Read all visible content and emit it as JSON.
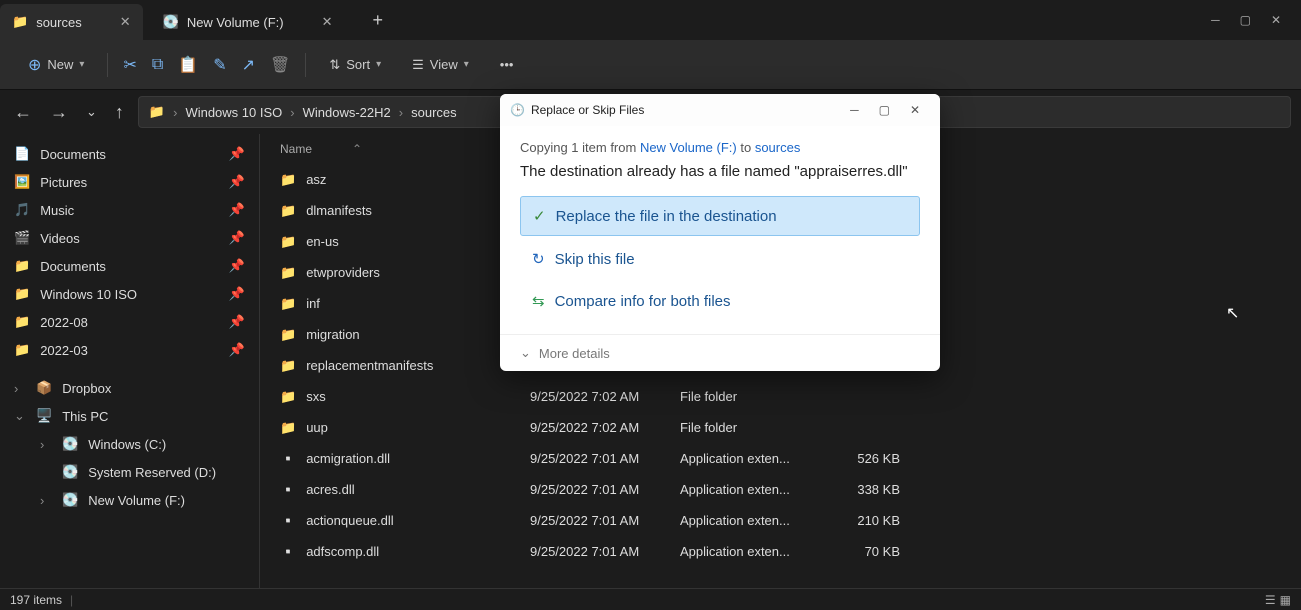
{
  "tabs": [
    {
      "label": "sources",
      "icon": "folder"
    },
    {
      "label": "New Volume (F:)",
      "icon": "drive"
    }
  ],
  "toolbar": {
    "new": "New",
    "sort": "Sort",
    "view": "View"
  },
  "breadcrumb": [
    "Windows 10 ISO",
    "Windows-22H2",
    "sources"
  ],
  "sidebar": {
    "quick": [
      {
        "label": "Documents",
        "icon": "doc"
      },
      {
        "label": "Pictures",
        "icon": "pic"
      },
      {
        "label": "Music",
        "icon": "music"
      },
      {
        "label": "Videos",
        "icon": "video"
      },
      {
        "label": "Documents",
        "icon": "folder"
      },
      {
        "label": "Windows 10 ISO",
        "icon": "folder"
      },
      {
        "label": "2022-08",
        "icon": "folder"
      },
      {
        "label": "2022-03",
        "icon": "folder"
      }
    ],
    "tree": [
      {
        "label": "Dropbox",
        "icon": "dropbox",
        "chev": "›"
      },
      {
        "label": "This PC",
        "icon": "pc",
        "chev": "⌄"
      },
      {
        "label": "Windows (C:)",
        "icon": "drive",
        "indent": true,
        "chev": "›"
      },
      {
        "label": "System Reserved (D:)",
        "icon": "drive",
        "indent": true,
        "chev": ""
      },
      {
        "label": "New Volume (F:)",
        "icon": "drive",
        "indent": true,
        "chev": "›"
      }
    ]
  },
  "columns": {
    "name": "Name"
  },
  "files": [
    {
      "name": "asz",
      "type": "folder"
    },
    {
      "name": "dlmanifests",
      "type": "folder"
    },
    {
      "name": "en-us",
      "type": "folder"
    },
    {
      "name": "etwproviders",
      "type": "folder"
    },
    {
      "name": "inf",
      "type": "folder"
    },
    {
      "name": "migration",
      "type": "folder"
    },
    {
      "name": "replacementmanifests",
      "type": "folder"
    },
    {
      "name": "sxs",
      "type": "folder",
      "date": "9/25/2022 7:02 AM",
      "ftype": "File folder"
    },
    {
      "name": "uup",
      "type": "folder",
      "date": "9/25/2022 7:02 AM",
      "ftype": "File folder"
    },
    {
      "name": "acmigration.dll",
      "type": "file",
      "date": "9/25/2022 7:01 AM",
      "ftype": "Application exten...",
      "size": "526 KB"
    },
    {
      "name": "acres.dll",
      "type": "file",
      "date": "9/25/2022 7:01 AM",
      "ftype": "Application exten...",
      "size": "338 KB"
    },
    {
      "name": "actionqueue.dll",
      "type": "file",
      "date": "9/25/2022 7:01 AM",
      "ftype": "Application exten...",
      "size": "210 KB"
    },
    {
      "name": "adfscomp.dll",
      "type": "file",
      "date": "9/25/2022 7:01 AM",
      "ftype": "Application exten...",
      "size": "70 KB"
    }
  ],
  "status": {
    "count": "197 items"
  },
  "dialog": {
    "title": "Replace or Skip Files",
    "copying_prefix": "Copying 1 item from ",
    "src": "New Volume (F:)",
    "to": " to ",
    "dst": "sources",
    "msg": "The destination already has a file named \"appraiserres.dll\"",
    "opt_replace": "Replace the file in the destination",
    "opt_skip": "Skip this file",
    "opt_compare": "Compare info for both files",
    "more": "More details"
  }
}
